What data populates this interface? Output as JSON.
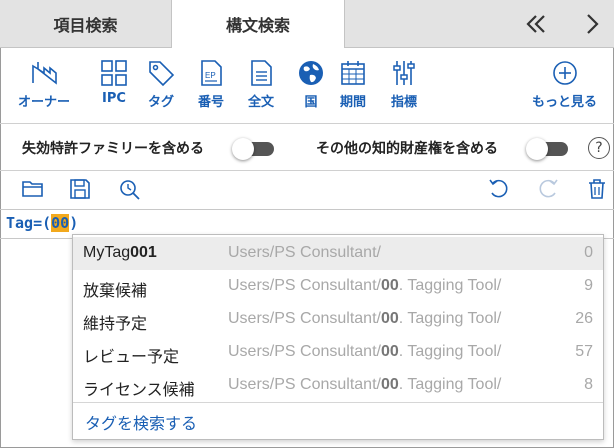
{
  "tabs": [
    {
      "label": "項目検索",
      "active": false
    },
    {
      "label": "構文検索",
      "active": true
    }
  ],
  "nav": {
    "back_icon": "double-chevron-left-icon",
    "next_icon": "chevron-right-icon"
  },
  "toolbar": {
    "items": [
      {
        "label": "オーナー",
        "icon": "factory-icon"
      },
      {
        "label": "IPC",
        "icon": "grid-icon"
      },
      {
        "label": "タグ",
        "icon": "tag-icon"
      },
      {
        "label": "番号",
        "icon": "ep-document-icon"
      },
      {
        "label": "全文",
        "icon": "document-icon"
      },
      {
        "label": "国",
        "icon": "globe-icon"
      },
      {
        "label": "期間",
        "icon": "calendar-icon"
      },
      {
        "label": "指標",
        "icon": "sliders-icon"
      },
      {
        "label": "もっと見る",
        "icon": "plus-circle-icon"
      }
    ]
  },
  "toggles": {
    "expired_family": {
      "label": "失効特許ファミリーを含める",
      "on": false
    },
    "other_ip": {
      "label": "その他の知的財産権を含める",
      "on": false
    },
    "help": "?"
  },
  "editor_tools": [
    "open-folder-icon",
    "save-icon",
    "history-search-icon",
    "undo-icon",
    "redo-icon",
    "trash-icon"
  ],
  "query": {
    "prefix": "Tag=(",
    "highlight": "00",
    "suffix": ")"
  },
  "autocomplete": {
    "items": [
      {
        "name_pre": "MyTag",
        "name_bold": "001",
        "path_pre": "Users/PS Consultant/",
        "path_bold": "",
        "path_post": "",
        "count": "0"
      },
      {
        "name_pre": "放棄候補",
        "name_bold": "",
        "path_pre": "Users/PS Consultant/",
        "path_bold": "00",
        "path_post": ". Tagging Tool/",
        "count": "9"
      },
      {
        "name_pre": "維持予定",
        "name_bold": "",
        "path_pre": "Users/PS Consultant/",
        "path_bold": "00",
        "path_post": ". Tagging Tool/",
        "count": "26"
      },
      {
        "name_pre": "レビュー予定",
        "name_bold": "",
        "path_pre": "Users/PS Consultant/",
        "path_bold": "00",
        "path_post": ". Tagging Tool/",
        "count": "57"
      },
      {
        "name_pre": "ライセンス候補",
        "name_bold": "",
        "path_pre": "Users/PS Consultant/",
        "path_bold": "00",
        "path_post": ". Tagging Tool/",
        "count": "8"
      }
    ],
    "search_link": "タグを検索する"
  },
  "colors": {
    "accent": "#1a5fb4",
    "highlight": "#f2a91d",
    "tab_inactive": "#e3e3e3"
  }
}
